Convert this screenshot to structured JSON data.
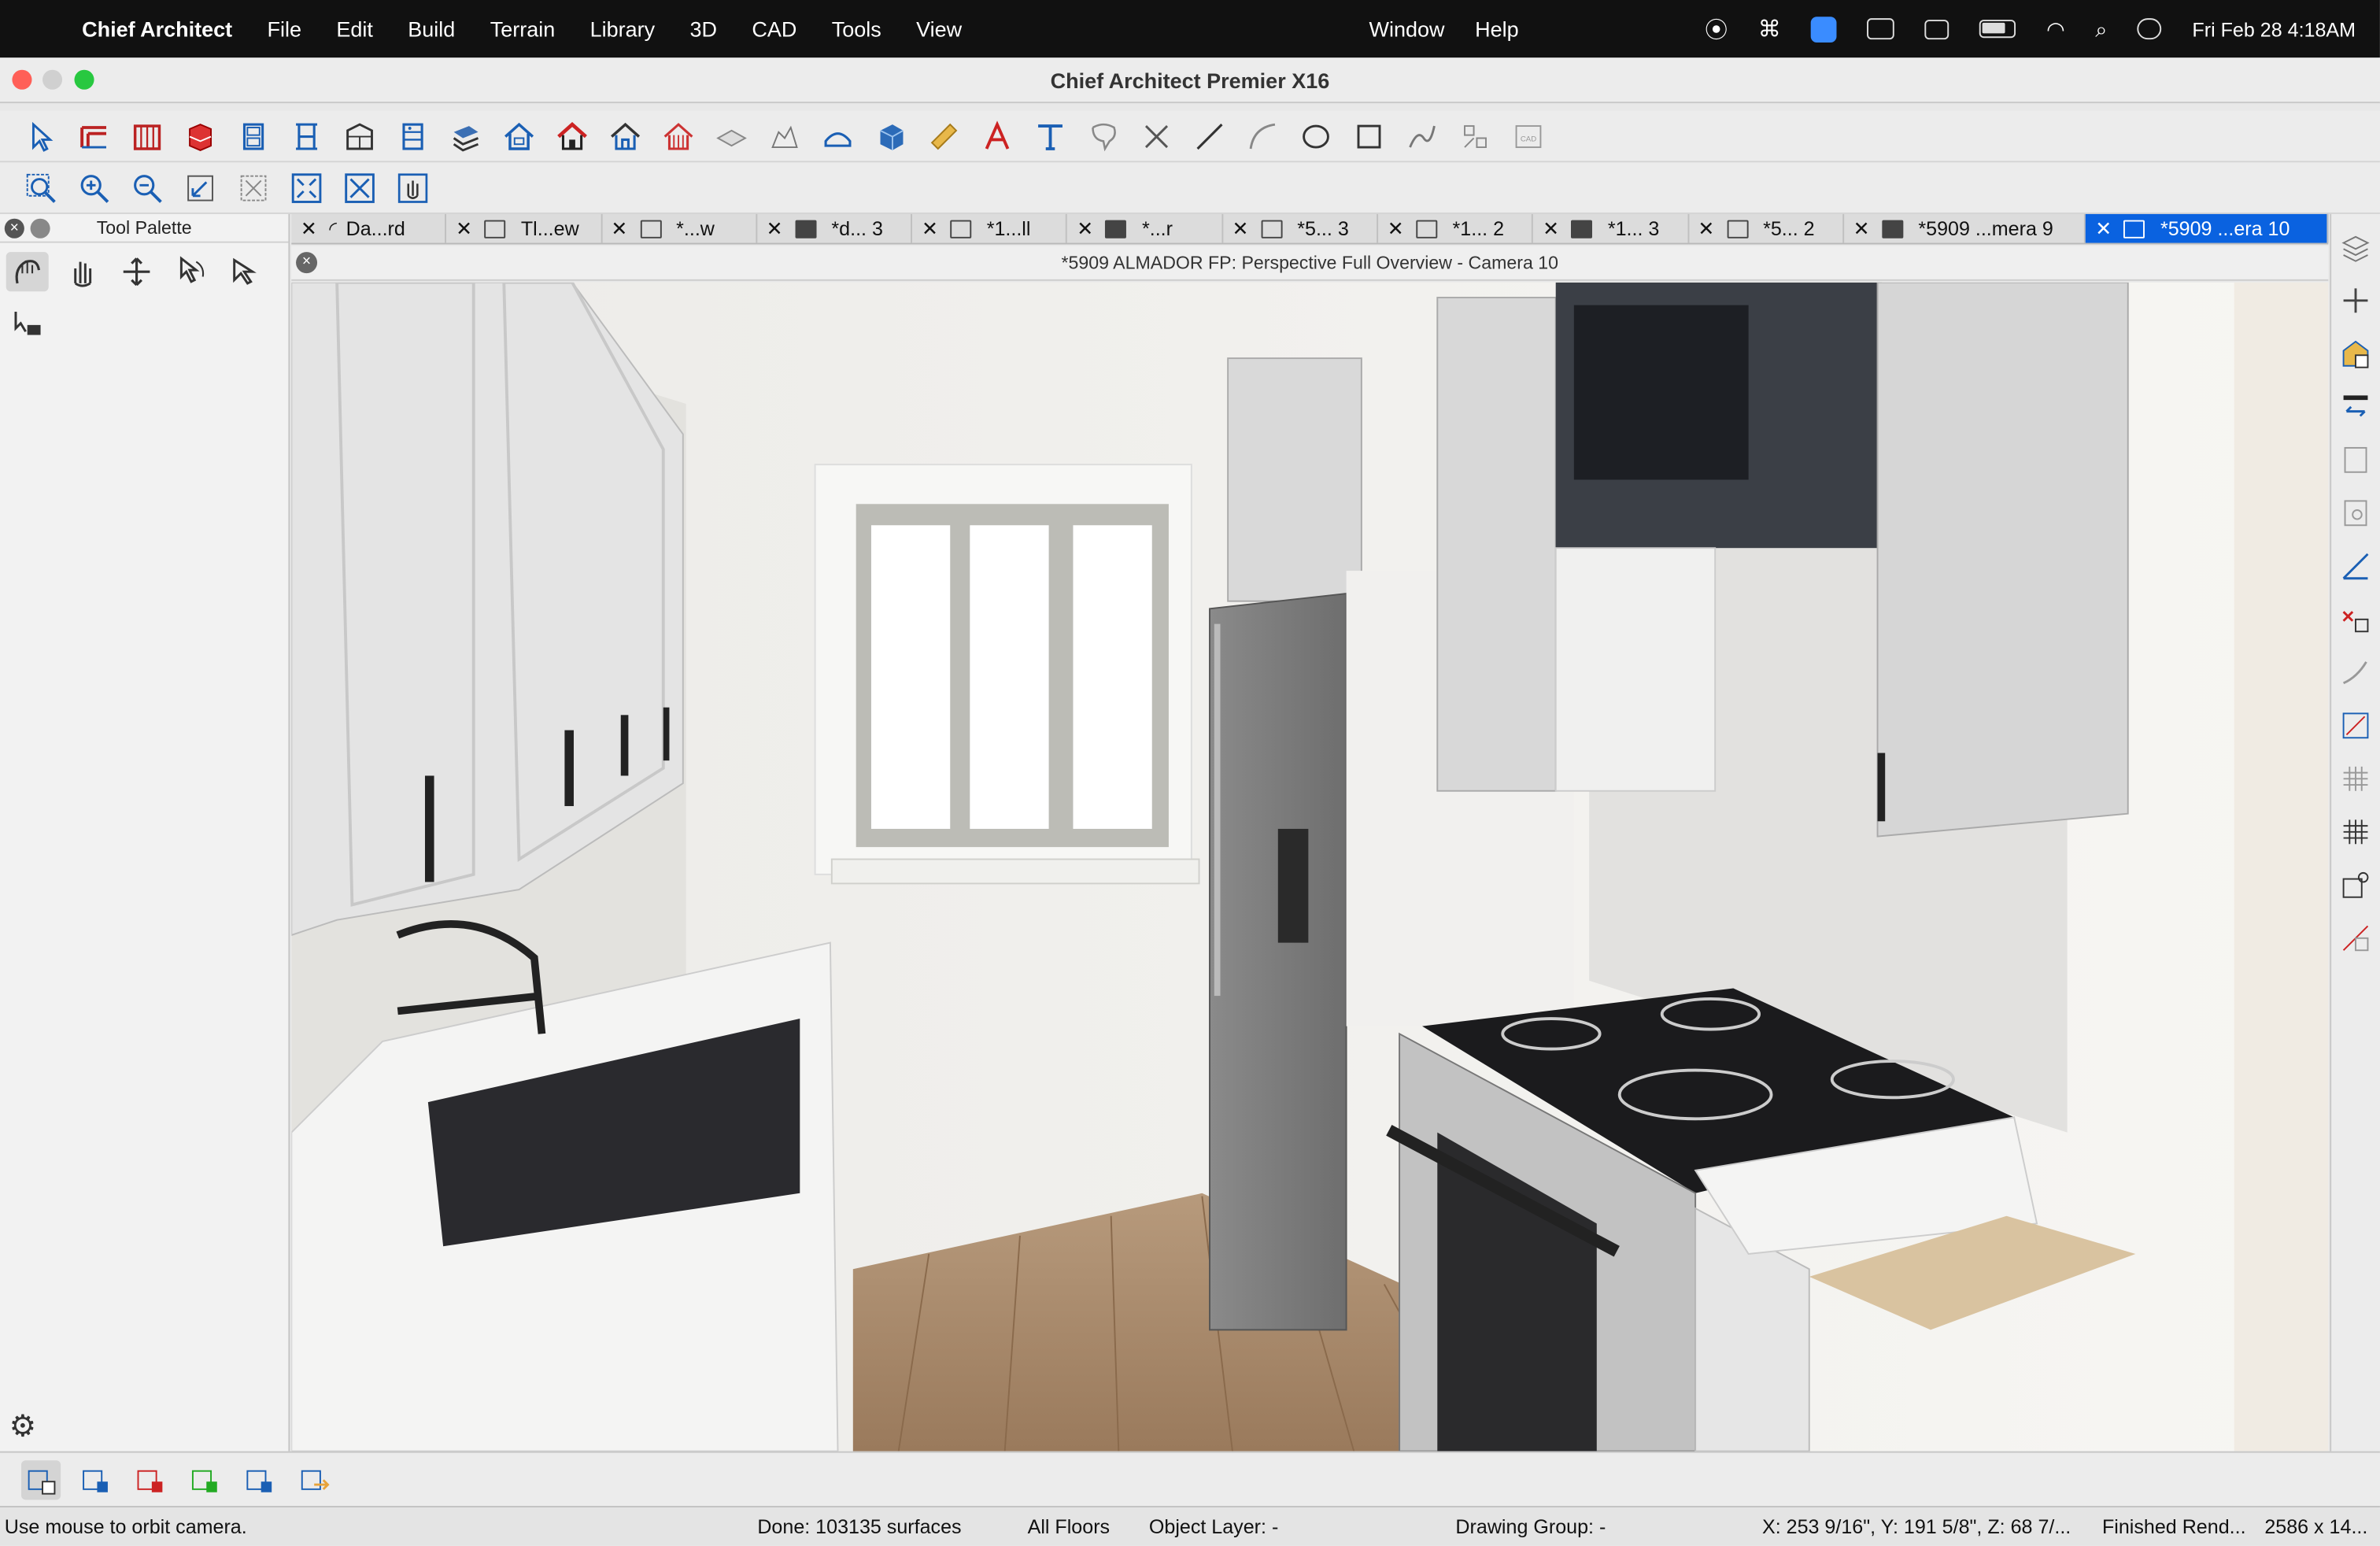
{
  "menubar": {
    "app_name": "Chief Architect",
    "menus": [
      "File",
      "Edit",
      "Build",
      "Terrain",
      "Library",
      "3D",
      "CAD",
      "Tools",
      "View"
    ],
    "right_menus": [
      "Window",
      "Help"
    ],
    "clock": "Fri Feb 28  4:18AM"
  },
  "window": {
    "title": "Chief Architect Premier X16"
  },
  "palette": {
    "title": "Tool Palette"
  },
  "tabs": [
    {
      "label": "Da...rd",
      "icon": "elevation-icon"
    },
    {
      "label": "Tl...ew",
      "icon": "plan-view-icon"
    },
    {
      "label": "*...w",
      "icon": "plan-view-icon"
    },
    {
      "label": "*d... 3",
      "icon": "camera-icon"
    },
    {
      "label": "*1...ll",
      "icon": "plan-view-icon"
    },
    {
      "label": "*...r",
      "icon": "camera-icon"
    },
    {
      "label": "*5... 3",
      "icon": "plan-view-icon"
    },
    {
      "label": "*1... 2",
      "icon": "plan-view-icon"
    },
    {
      "label": "*1... 3",
      "icon": "camera-icon"
    },
    {
      "label": "*5... 2",
      "icon": "plan-view-icon"
    },
    {
      "label": "*5909 ...mera 9",
      "icon": "camera-icon"
    },
    {
      "label": "*5909 ...era 10",
      "icon": "camera-icon",
      "active": true
    }
  ],
  "view": {
    "title": "*5909 ALMADOR FP: Perspective Full Overview - Camera 10"
  },
  "status": {
    "hint": "Use mouse to orbit camera.",
    "done": "Done:  103135 surfaces",
    "floors": "All Floors",
    "object_layer": "Object Layer: -",
    "drawing_group": "Drawing Group: -",
    "coords": "X: 253 9/16\", Y: 191 5/8\", Z: 68 7/...",
    "render": "Finished Rend...",
    "size": "2586 x 14..."
  },
  "colors": {
    "active_tab": "#0a62e0",
    "menubar": "#111111"
  }
}
